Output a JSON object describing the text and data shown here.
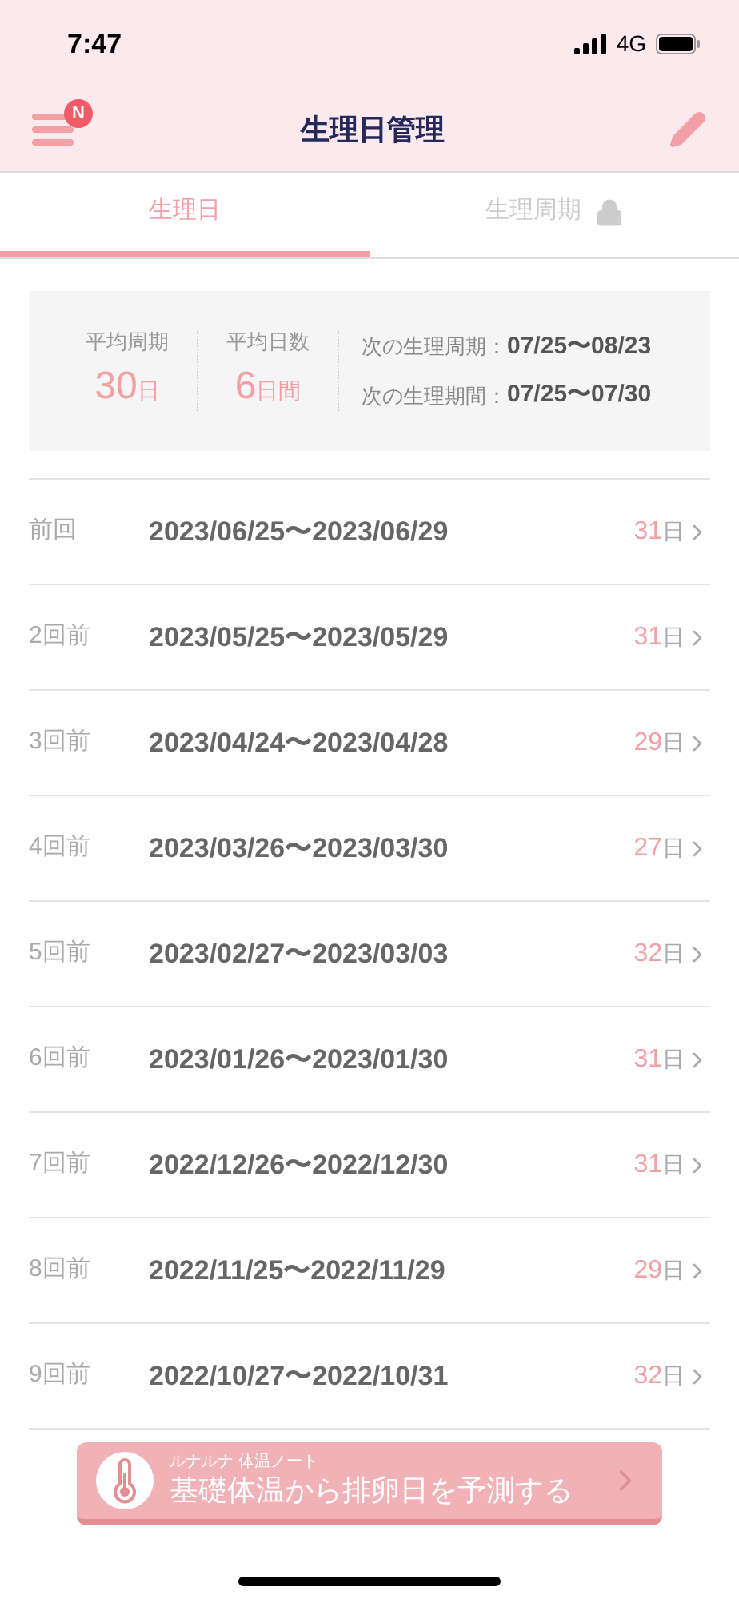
{
  "status_bar": {
    "time": "7:47",
    "network": "4G"
  },
  "header": {
    "title": "生理日管理",
    "menu_badge": "N"
  },
  "tabs": [
    {
      "label": "生理日",
      "selected": true,
      "locked": false
    },
    {
      "label": "生理周期",
      "selected": false,
      "locked": true
    }
  ],
  "summary": {
    "stats": [
      {
        "label": "平均周期",
        "value": "30",
        "unit": "日"
      },
      {
        "label": "平均日数",
        "value": "6",
        "unit": "日間"
      }
    ],
    "next": [
      {
        "label": "次の生理周期：",
        "range": "07/25〜08/23"
      },
      {
        "label": "次の生理期間：",
        "range": "07/25〜07/30"
      }
    ]
  },
  "periods": [
    {
      "label": "前回",
      "range": "2023/06/25〜2023/06/29",
      "days": "31",
      "unit": "日"
    },
    {
      "label": "2回前",
      "range": "2023/05/25〜2023/05/29",
      "days": "31",
      "unit": "日"
    },
    {
      "label": "3回前",
      "range": "2023/04/24〜2023/04/28",
      "days": "29",
      "unit": "日"
    },
    {
      "label": "4回前",
      "range": "2023/03/26〜2023/03/30",
      "days": "27",
      "unit": "日"
    },
    {
      "label": "5回前",
      "range": "2023/02/27〜2023/03/03",
      "days": "32",
      "unit": "日"
    },
    {
      "label": "6回前",
      "range": "2023/01/26〜2023/01/30",
      "days": "31",
      "unit": "日"
    },
    {
      "label": "7回前",
      "range": "2022/12/26〜2022/12/30",
      "days": "31",
      "unit": "日"
    },
    {
      "label": "8回前",
      "range": "2022/11/25〜2022/11/29",
      "days": "29",
      "unit": "日"
    },
    {
      "label": "9回前",
      "range": "2022/10/27〜2022/10/31",
      "days": "32",
      "unit": "日"
    }
  ],
  "banner": {
    "subtitle": "ルナルナ 体温ノート",
    "title": "基礎体温から排卵日を予測する"
  }
}
